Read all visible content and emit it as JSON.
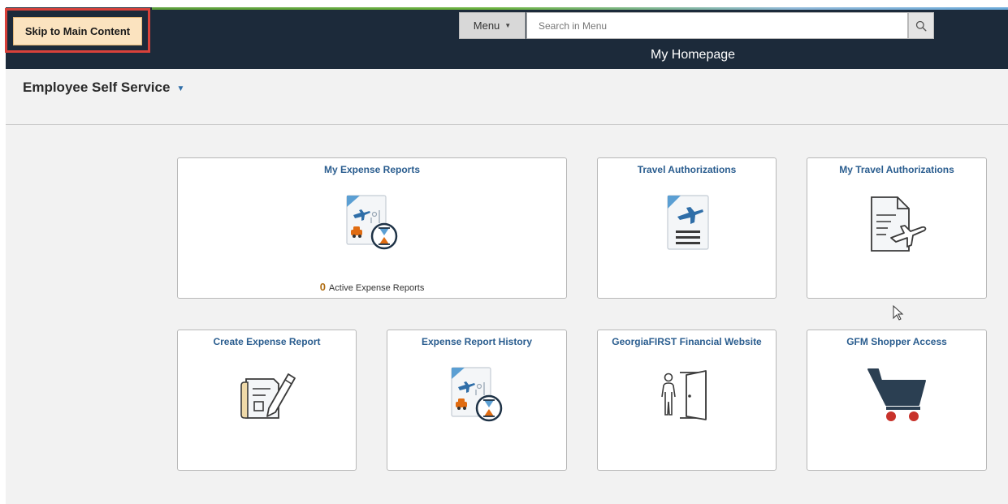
{
  "header": {
    "skip_link": "Skip to Main Content",
    "menu_label": "Menu",
    "search_placeholder": "Search in Menu",
    "page_title": "My Homepage"
  },
  "homepage_selector": {
    "label": "Employee Self Service"
  },
  "tiles": [
    {
      "title": "My Expense Reports",
      "icon": "expense-report-icon",
      "count": "0",
      "count_label": "Active Expense Reports"
    },
    {
      "title": "Travel Authorizations",
      "icon": "travel-authorization-icon"
    },
    {
      "title": "My Travel Authorizations",
      "icon": "travel-document-icon"
    },
    {
      "title": "Create Expense Report",
      "icon": "create-report-icon"
    },
    {
      "title": "Expense Report History",
      "icon": "expense-history-icon"
    },
    {
      "title": "GeorgiaFIRST Financial Website",
      "icon": "exit-door-icon"
    },
    {
      "title": "GFM Shopper Access",
      "icon": "shopping-cart-icon"
    }
  ],
  "colors": {
    "header_bg": "#1c2a3a",
    "tile_title": "#2a5d8f",
    "skip_highlight": "#d9413a",
    "count_accent": "#b06d12"
  }
}
